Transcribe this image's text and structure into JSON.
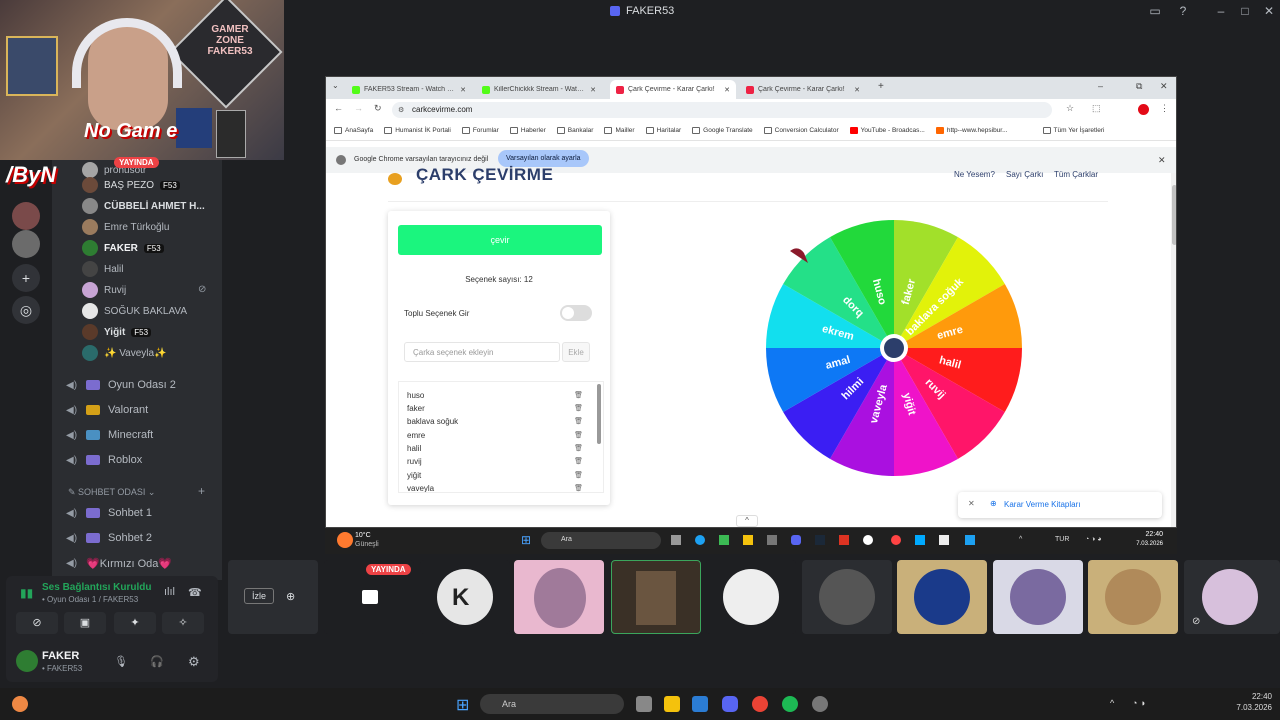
{
  "window": {
    "title": "FAKER53"
  },
  "overlay": {
    "line1": "No Gam e",
    "line2": "/ByN",
    "webcam_sign": "GAMER ZONE FAKER53"
  },
  "channel_list": {
    "users": [
      {
        "name": "prohusotr",
        "badge": "YAYINDA",
        "color": "#a5a5a5"
      },
      {
        "name": "BAŞ PEZO",
        "badge": "F53",
        "color": "#6b4a3a"
      },
      {
        "name": "CÜBBELİ AHMET H...",
        "badge": "",
        "color": "#888"
      },
      {
        "name": "Emre Türkoğlu",
        "badge": "",
        "color": "#9a7b5e"
      },
      {
        "name": "FAKER",
        "badge": "F53",
        "color": "#2e7d32"
      },
      {
        "name": "Halil",
        "badge": "",
        "color": "#444"
      },
      {
        "name": "Ruvij",
        "badge": "",
        "color": "#c7a4d4"
      },
      {
        "name": "SOĞUK BAKLAVA",
        "badge": "",
        "color": "#e6e6e6"
      },
      {
        "name": "Yiğit",
        "badge": "F53",
        "color": "#5a3a2a"
      },
      {
        "name": "✨ Vaveyla✨",
        "badge": "",
        "color": "#2a6b6b"
      }
    ],
    "voice_channels": [
      {
        "name": "Oyun Odası 2",
        "color": "#7b6ccf"
      },
      {
        "name": "Valorant",
        "color": "#d4a017"
      },
      {
        "name": "Minecraft",
        "color": "#4a90c2"
      },
      {
        "name": "Roblox",
        "color": "#7b6ccf"
      }
    ],
    "category": "SOHBET ODASI",
    "sohbet_channels": [
      {
        "name": "Sohbet 1",
        "color": "#7b6ccf"
      },
      {
        "name": "Sohbet 2",
        "color": "#7b6ccf"
      },
      {
        "name": "💗Kırmızı Oda💗",
        "color": "#e05c8a"
      }
    ],
    "live_badge": "YAYINDA"
  },
  "voice_panel": {
    "status": "Ses Bağlantısı Kuruldu",
    "sub": "• Oyun Odası 1 / FAKER53",
    "user": "FAKER",
    "user_sub": "• FAKER53"
  },
  "browser": {
    "tabs": [
      {
        "label": "FAKER53 Stream - Watch Live o...",
        "color": "#53fc18",
        "active": false
      },
      {
        "label": "KillerChickkk Stream - Watch Li...",
        "color": "#53fc18",
        "active": false
      },
      {
        "label": "Çark Çevirme - Karar Çarkı!",
        "color": "#e24",
        "active": true
      },
      {
        "label": "Çark Çevirme - Karar Çarkı!",
        "color": "#e24",
        "active": false
      }
    ],
    "url": "carkcevirme.com",
    "bookmarks": [
      "AnaSayfa",
      "Humanist İK Portali",
      "Forumlar",
      "Haberler",
      "Bankalar",
      "Mailler",
      "Haritalar",
      "Google Translate",
      "Conversion Calculator",
      "YouTube - Broadcas...",
      "http--www.hepsibur..."
    ],
    "bookmarks_right": "Tüm Yer İşaretleri",
    "infobar_text": "Google Chrome varsayılan tarayıcınız değil",
    "infobar_button": "Varsayılan olarak ayarla"
  },
  "site": {
    "logo": "ÇARK ÇEVİRME",
    "nav": [
      "Ne Yesem?",
      "Sayı Çarkı",
      "Tüm Çarklar"
    ],
    "spin_button": "çevir",
    "count_text": "Seçenek sayısı: 12",
    "bulk_label": "Toplu Seçenek Gir",
    "input_placeholder": "Çarka seçenek ekleyin",
    "add_button": "Ekle",
    "options": [
      "huso",
      "faker",
      "baklava soğuk",
      "emre",
      "halil",
      "ruvij",
      "yiğit",
      "vaveyla"
    ],
    "wheel_labels": [
      "faker",
      "baklava soğuk",
      "emre",
      "halil",
      "ruvij",
      "yiğit",
      "vaveyla",
      "hilmi",
      "amal",
      "ekrem",
      "dorq",
      "huso"
    ],
    "wheel_colors": [
      "#a2e02a",
      "#e2f20a",
      "#ff9a0c",
      "#ff1c1c",
      "#ff1569",
      "#ef13c9",
      "#aa10e0",
      "#3b1ef3",
      "#0d78f5",
      "#12dfee",
      "#24e088",
      "#22d93b"
    ],
    "karar_link": "Karar Verme Kitapları"
  },
  "taskbar": {
    "weather": "10°C",
    "weather_sub": "Güneşli",
    "search": "Ara",
    "lang": "TUR",
    "time": "22:40",
    "date": "7.03.2026"
  },
  "streams": {
    "live_badge": "YAYINDA",
    "izle": "İzle"
  },
  "bottombar": {
    "search": "Ara",
    "time": "22:40",
    "date": "7.03.2026"
  }
}
